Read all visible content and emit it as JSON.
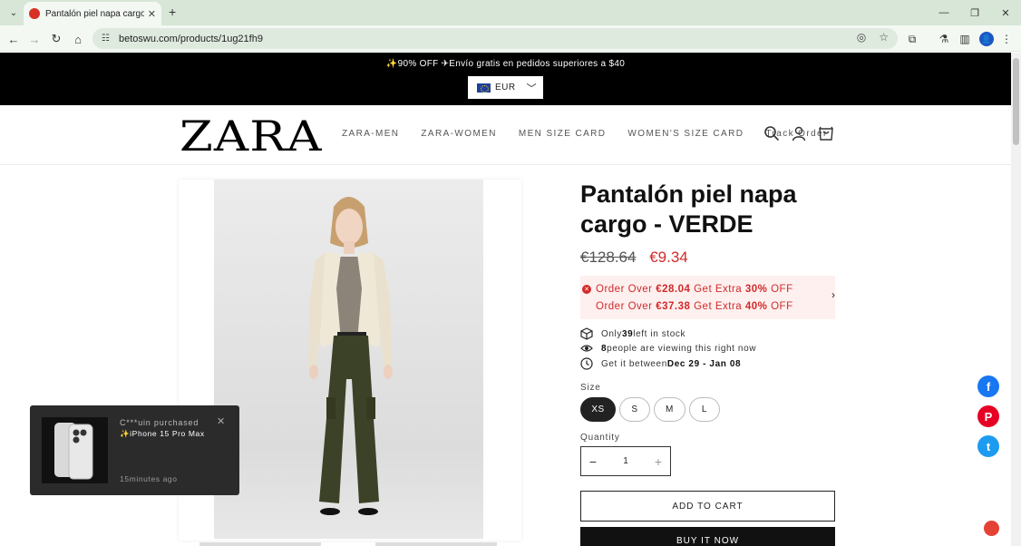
{
  "browser": {
    "tab_title": "Pantalón piel napa cargo - VERDE",
    "url": "betoswu.com/products/1ug21fh9",
    "avatar_initial": "👤"
  },
  "announcement": {
    "text": "✨90% OFF ✈Envío gratis en pedidos superiores a $40",
    "currency": "EUR"
  },
  "header": {
    "logo": "ZARA",
    "nav": [
      "ZARA-MEN",
      "ZARA-WOMEN",
      "MEN SIZE CARD",
      "WOMEN'S SIZE CARD",
      "Track Order"
    ]
  },
  "product": {
    "title": "Pantalón piel napa cargo - VERDE",
    "old_price": "€128.64",
    "new_price": "€9.34",
    "offers": [
      {
        "pre": "Order Over ",
        "amount": "€28.04",
        "mid": " Get Extra ",
        "pct": "30%",
        "post": " OFF"
      },
      {
        "pre": "Order Over ",
        "amount": "€37.38",
        "mid": " Get Extra ",
        "pct": "40%",
        "post": " OFF"
      }
    ],
    "stock": {
      "pre": "Only ",
      "count": "39",
      "post": " left in stock"
    },
    "viewers": {
      "count": "8",
      "post": " people are viewing this right now"
    },
    "delivery": {
      "pre": "Get it between ",
      "dates": "Dec 29 - Jan 08"
    },
    "size_label": "Size",
    "sizes": [
      "XS",
      "S",
      "M",
      "L"
    ],
    "selected_size": "XS",
    "qty_label": "Quantity",
    "qty": "1",
    "add_to_cart": "ADD TO CART",
    "buy_now": "BUY IT NOW"
  },
  "toast": {
    "buyer": "C***uin purchased",
    "product": "✨iPhone 15 Pro Max",
    "time": "15minutes ago"
  },
  "social": [
    "f",
    "P",
    "t"
  ],
  "colors": {
    "sale": "#d12a2a",
    "facebook": "#1877f2",
    "pinterest": "#e60023",
    "twitter": "#1d9bf0"
  }
}
